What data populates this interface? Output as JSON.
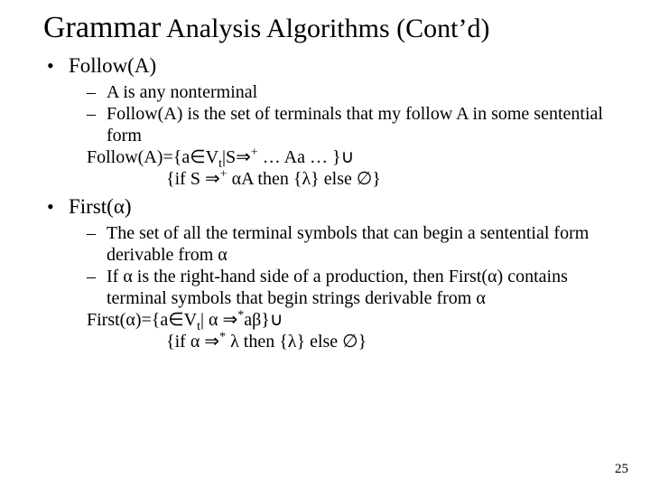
{
  "title_a": "Grammar",
  "title_b": " Analysis Algorithms (Cont’d)",
  "bullet1": "Follow(A)",
  "b1_s1": "A is any nonterminal",
  "b1_s2": "Follow(A) is the set of terminals that my follow A in some sentential form",
  "b1_f1": "Follow(A)={a∈V",
  "b1_f1_sub": "t",
  "b1_f1b": "|S⇒",
  "b1_f1_sup": "+",
  "b1_f1c": " … Aa … }∪",
  "b1_f2": "{if S ⇒",
  "b1_f2_sup": "+",
  "b1_f2b": " αA then {λ} else ∅}",
  "bullet2": "First(α)",
  "b2_s1": "The set of all the terminal symbols that can begin a sentential form derivable from α",
  "b2_s2": "If α is the right-hand side of a production, then First(α) contains terminal symbols that begin strings derivable from α",
  "b2_f1": "First(α)={a∈V",
  "b2_f1_sub": "t",
  "b2_f1b": "| α ⇒",
  "b2_f1_sup": "*",
  "b2_f1c": "aβ}∪",
  "b2_f2": "{if α ⇒",
  "b2_f2_sup": "*",
  "b2_f2b": " λ then {λ} else ∅}",
  "page": "25"
}
